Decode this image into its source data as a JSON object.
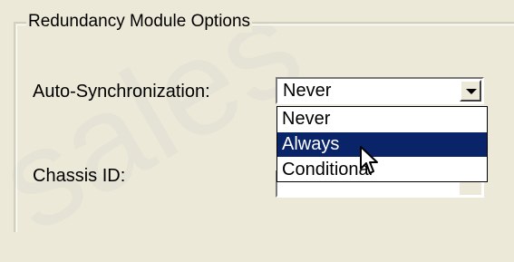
{
  "window": {
    "title": "Redundancy Module Options",
    "watermark": "sales"
  },
  "fields": {
    "auto_sync": {
      "label": "Auto-Synchronization:",
      "selected": "Never",
      "options": [
        "Never",
        "Always",
        "Conditional"
      ],
      "highlighted": "Always"
    },
    "chassis_id": {
      "label": "Chassis ID:"
    }
  },
  "colors": {
    "background": "#ece9d8",
    "selection": "#0a246a"
  },
  "icons": {
    "dropdown": "chevron-down-icon",
    "cursor": "mouse-pointer-icon"
  }
}
